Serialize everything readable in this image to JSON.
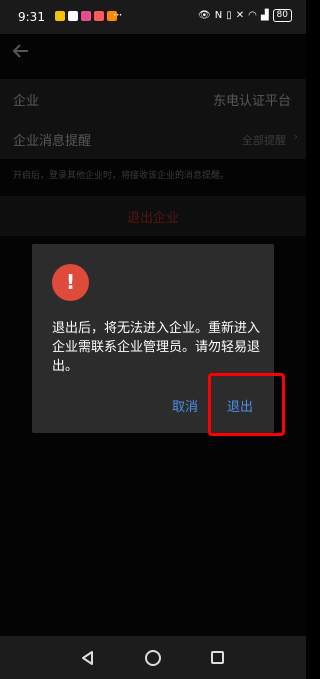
{
  "status_bar": {
    "time": "9:31",
    "dots": "···",
    "battery": "80",
    "app_icon_colors": [
      "#f5c400",
      "#ffffff",
      "#e84d8a",
      "#ff5a5a",
      "#ff8a00"
    ]
  },
  "header": {
    "back_icon": "arrow-left-icon"
  },
  "settings": {
    "company_label": "企业",
    "company_value": "东电认证平台",
    "reminder_label": "企业消息提醒",
    "reminder_value": "全部提醒",
    "hint": "开启后，登录其他企业时，将接收该企业的消息提醒。",
    "exit_label": "退出企业"
  },
  "dialog": {
    "icon": "alert-icon",
    "icon_glyph": "!",
    "message": "退出后，将无法进入企业。重新进入企业需联系企业管理员。请勿轻易退出。",
    "cancel_label": "取消",
    "confirm_label": "退出"
  },
  "colors": {
    "accent_blue": "#4f8fe6",
    "alert_red": "#e04a3a",
    "highlight_red": "#ff0000"
  }
}
